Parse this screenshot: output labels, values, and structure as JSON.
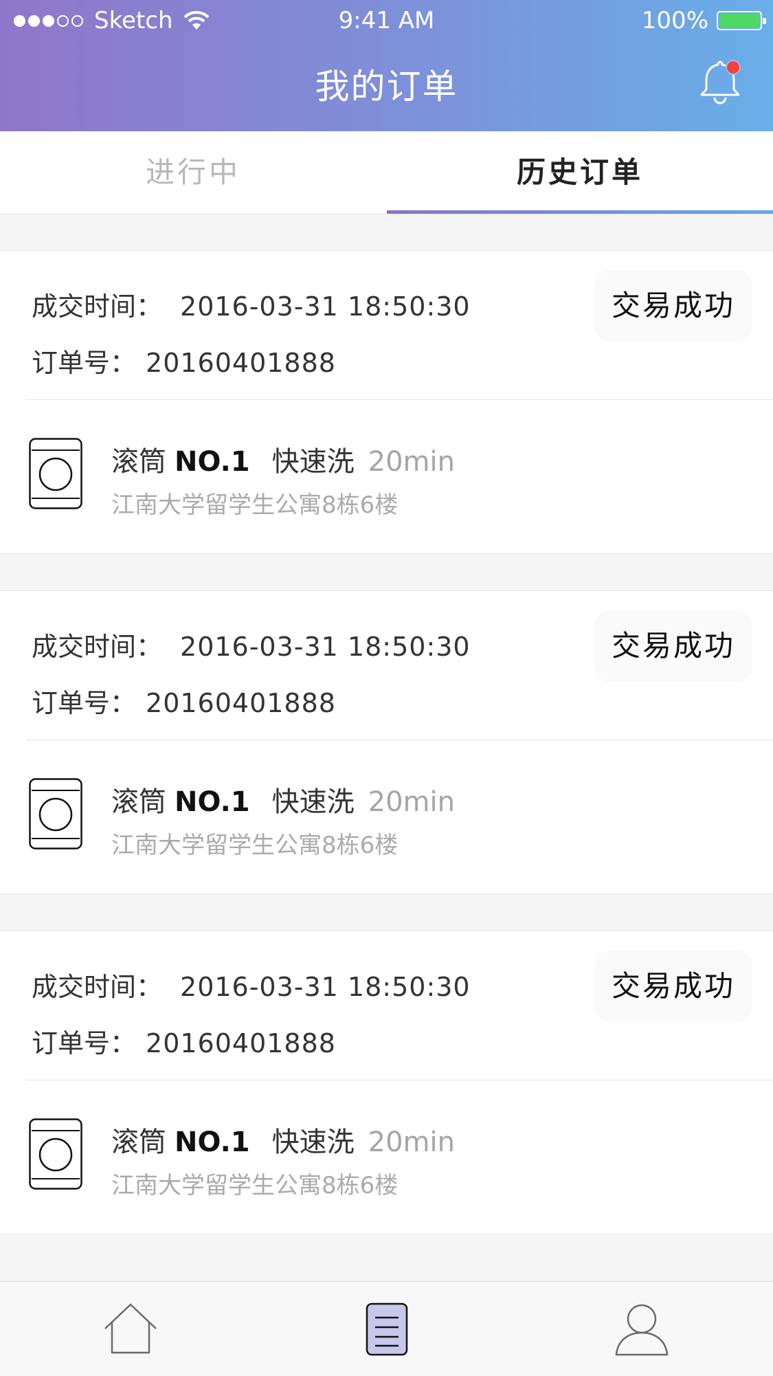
{
  "status_bar": {
    "carrier": "Sketch",
    "time": "9:41 AM",
    "battery": "100%"
  },
  "header": {
    "title": "我的订单",
    "notification_icon": "bell-icon",
    "has_unread": true
  },
  "tabs": [
    {
      "label": "进行中",
      "active": false
    },
    {
      "label": "历史订单",
      "active": true
    }
  ],
  "orders": [
    {
      "time_label": "成交时间：",
      "time": "2016-03-31 18:50:30",
      "order_no_label": "订单号：",
      "order_no": "20160401888",
      "status": "交易成功",
      "machine_type": "滚筒",
      "machine_no": "NO.1",
      "mode": "快速洗",
      "duration": "20min",
      "address": "江南大学留学生公寓8栋6楼"
    },
    {
      "time_label": "成交时间：",
      "time": "2016-03-31 18:50:30",
      "order_no_label": "订单号：",
      "order_no": "20160401888",
      "status": "交易成功",
      "machine_type": "滚筒",
      "machine_no": "NO.1",
      "mode": "快速洗",
      "duration": "20min",
      "address": "江南大学留学生公寓8栋6楼"
    },
    {
      "time_label": "成交时间：",
      "time": "2016-03-31 18:50:30",
      "order_no_label": "订单号：",
      "order_no": "20160401888",
      "status": "交易成功",
      "machine_type": "滚筒",
      "machine_no": "NO.1",
      "mode": "快速洗",
      "duration": "20min",
      "address": "江南大学留学生公寓8栋6楼"
    }
  ],
  "bottom_nav": [
    {
      "icon": "home-icon",
      "active": false
    },
    {
      "icon": "orders-icon",
      "active": true
    },
    {
      "icon": "profile-icon",
      "active": false
    }
  ],
  "colors": {
    "header_gradient_start": "#9076c9",
    "header_gradient_end": "#68aee9",
    "notification_dot": "#f2443f",
    "battery": "#4cd964",
    "active_nav_fill": "#c9c6ec"
  }
}
